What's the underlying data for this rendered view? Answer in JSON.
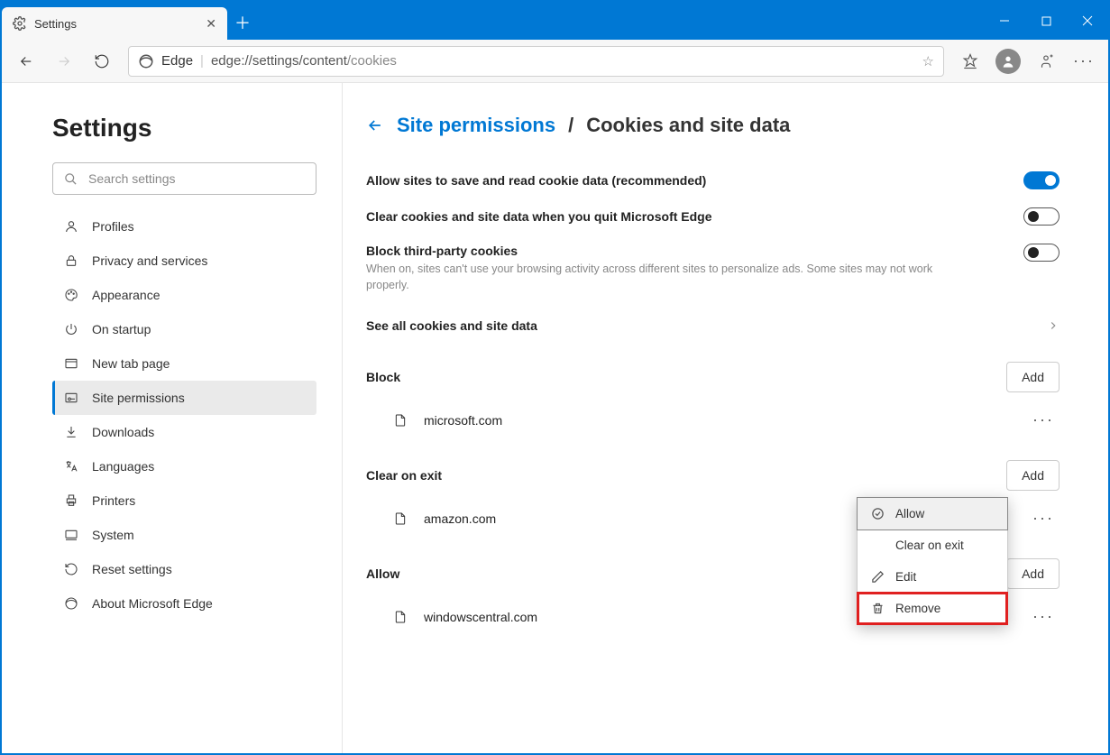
{
  "window": {
    "tab_title": "Settings",
    "address_scheme": "Edge",
    "address_url_dark": "edge://settings/content",
    "address_url_light": "/cookies"
  },
  "sidebar": {
    "heading": "Settings",
    "search_placeholder": "Search settings",
    "items": [
      {
        "label": "Profiles",
        "icon": "person-icon"
      },
      {
        "label": "Privacy and services",
        "icon": "lock-icon"
      },
      {
        "label": "Appearance",
        "icon": "palette-icon"
      },
      {
        "label": "On startup",
        "icon": "power-icon"
      },
      {
        "label": "New tab page",
        "icon": "tab-icon"
      },
      {
        "label": "Site permissions",
        "icon": "permissions-icon",
        "active": true
      },
      {
        "label": "Downloads",
        "icon": "download-icon"
      },
      {
        "label": "Languages",
        "icon": "language-icon"
      },
      {
        "label": "Printers",
        "icon": "printer-icon"
      },
      {
        "label": "System",
        "icon": "system-icon"
      },
      {
        "label": "Reset settings",
        "icon": "reset-icon"
      },
      {
        "label": "About Microsoft Edge",
        "icon": "edge-icon"
      }
    ]
  },
  "breadcrumb": {
    "parent": "Site permissions",
    "current": "Cookies and site data"
  },
  "toggles": {
    "allow_label": "Allow sites to save and read cookie data (recommended)",
    "clear_label": "Clear cookies and site data when you quit Microsoft Edge",
    "block_label": "Block third-party cookies",
    "block_desc": "When on, sites can't use your browsing activity across different sites to personalize ads. Some sites may not work properly."
  },
  "seeall": "See all cookies and site data",
  "sections": {
    "block": {
      "title": "Block",
      "add": "Add",
      "items": [
        {
          "site": "microsoft.com"
        }
      ]
    },
    "clear": {
      "title": "Clear on exit",
      "add": "Add",
      "items": [
        {
          "site": "amazon.com"
        }
      ]
    },
    "allow": {
      "title": "Allow",
      "add": "Add",
      "items": [
        {
          "site": "windowscentral.com"
        }
      ]
    }
  },
  "context_menu": {
    "allow": "Allow",
    "clear": "Clear on exit",
    "edit": "Edit",
    "remove": "Remove"
  }
}
